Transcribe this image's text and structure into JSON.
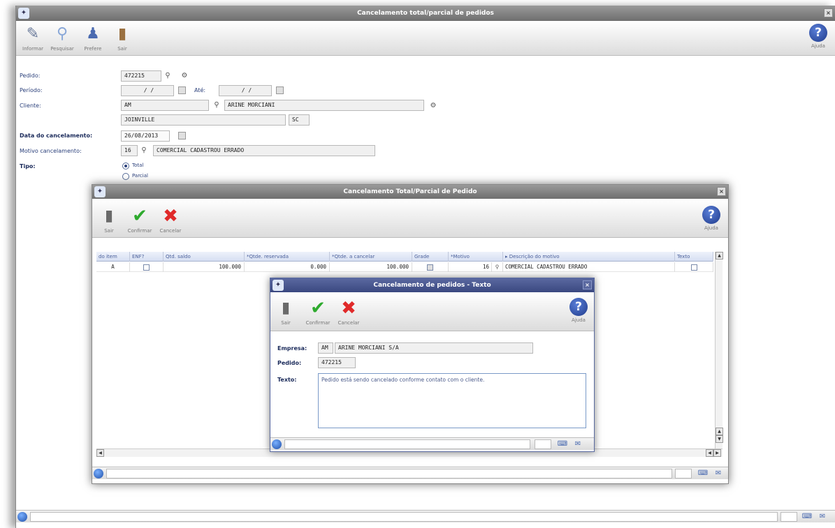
{
  "main": {
    "title": "Cancelamento total/parcial de pedidos",
    "toolbar": {
      "informar": "Informar",
      "pesquisar": "Pesquisar",
      "prefere": "Prefere",
      "sair": "Sair",
      "ajuda": "Ajuda"
    },
    "form": {
      "pedido_label": "Pedido:",
      "pedido_value": "472215",
      "periodo_label": "Período:",
      "periodo_from": "/ /",
      "ate_label": "Até:",
      "periodo_to": "/ /",
      "cliente_label": "Cliente:",
      "cliente_code": "AM",
      "cliente_name": "ARINE MORCIANI",
      "cidade": "JOINVILLE",
      "uf": "SC",
      "data_label": "Data do cancelamento:",
      "data_value": "26/08/2013",
      "motivo_label": "Motivo cancelamento:",
      "motivo_code": "16",
      "motivo_desc": "COMERCIAL CADASTROU ERRADO",
      "tipo_label": "Tipo:",
      "tipo_total": "Total",
      "tipo_parcial": "Parcial"
    }
  },
  "dialog": {
    "title": "Cancelamento Total/Parcial de Pedido",
    "toolbar": {
      "sair": "Sair",
      "confirmar": "Confirmar",
      "cancelar": "Cancelar",
      "ajuda": "Ajuda"
    },
    "grid": {
      "headers": [
        "do item",
        "ENF?",
        "Qtd. saldo",
        "*Qtde. reservada",
        "*Qtde. a cancelar",
        "Grade",
        "*Motivo",
        "▸ Descrição do motivo",
        "Texto"
      ],
      "row": {
        "item": "A",
        "saldo": "100.000",
        "reservada": "0.000",
        "cancelar": "100.000",
        "motivo": "16",
        "descricao": "COMERCIAL CADASTROU ERRADO"
      }
    }
  },
  "text_dialog": {
    "title": "Cancelamento de pedidos - Texto",
    "toolbar": {
      "sair": "Sair",
      "confirmar": "Confirmar",
      "cancelar": "Cancelar",
      "ajuda": "Ajuda"
    },
    "empresa_label": "Empresa:",
    "empresa_code": "AM",
    "empresa_name": "ARINE MORCIANI S/A",
    "pedido_label": "Pedido:",
    "pedido_value": "472215",
    "texto_label": "Texto:",
    "texto_value": "Pedido está sendo cancelado conforme contato com o cliente."
  },
  "colors": {
    "title_gray": "#7a7a7a",
    "text_dialog_title": "#3e4c86",
    "grid_header": "#d6dff2"
  }
}
